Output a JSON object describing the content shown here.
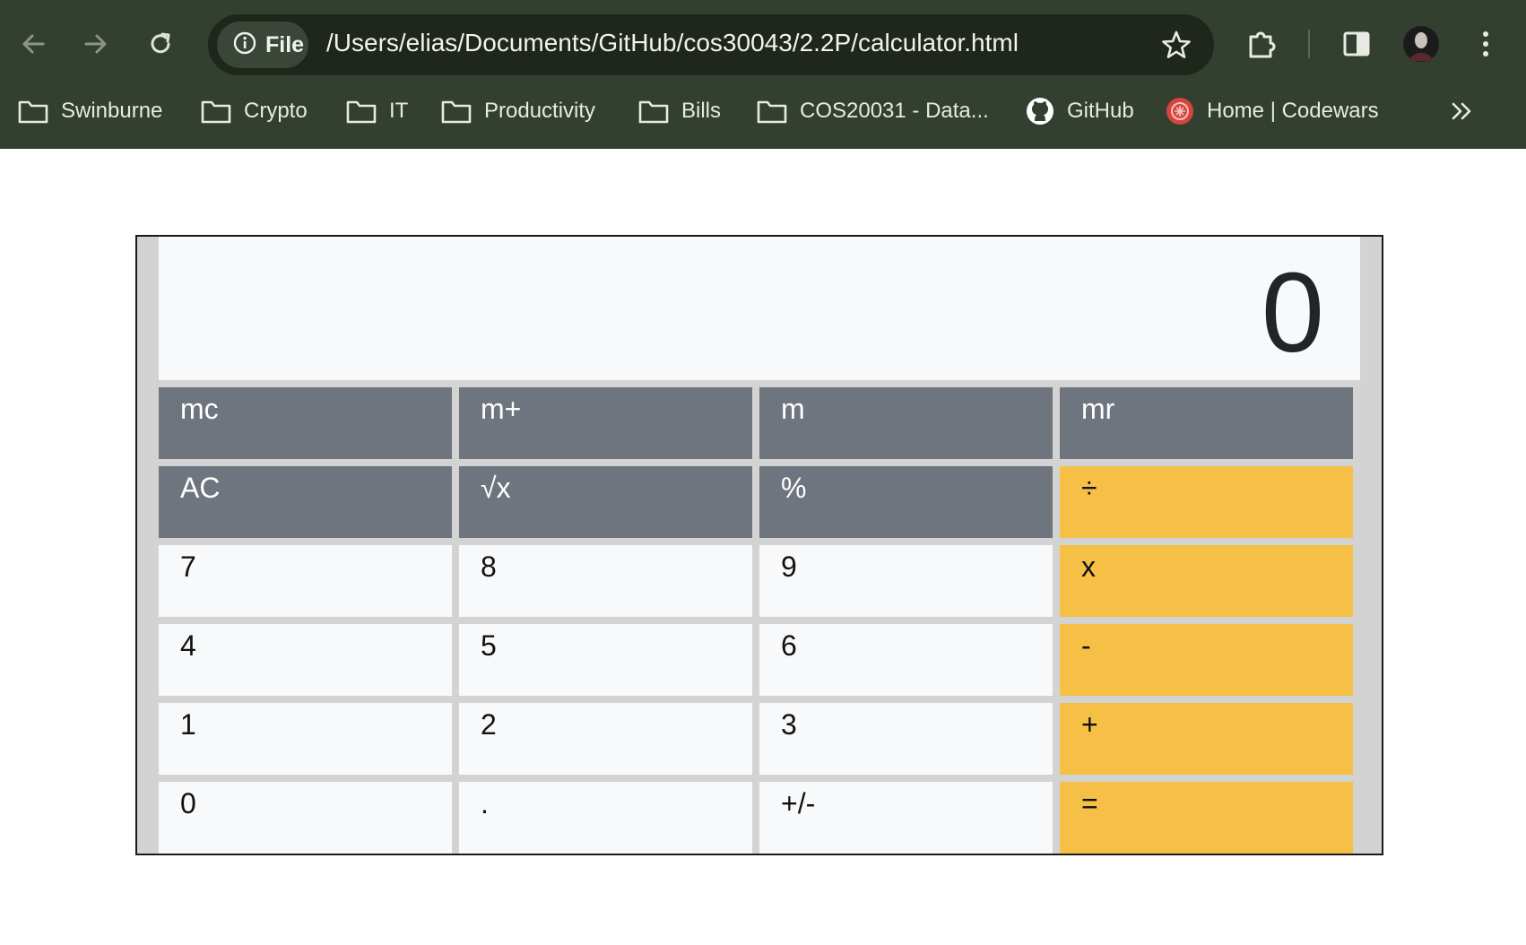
{
  "browser": {
    "file_chip_label": "File",
    "url": "/Users/elias/Documents/GitHub/cos30043/2.2P/calculator.html",
    "chrome_color": "#333f2f",
    "bookmarks": [
      {
        "label": "Swinburne",
        "icon": "folder-icon"
      },
      {
        "label": "Crypto",
        "icon": "folder-icon"
      },
      {
        "label": "IT",
        "icon": "folder-icon"
      },
      {
        "label": "Productivity",
        "icon": "folder-icon"
      },
      {
        "label": "Bills",
        "icon": "folder-icon"
      },
      {
        "label": "COS20031 - Data...",
        "icon": "folder-icon"
      },
      {
        "label": "GitHub",
        "icon": "github-icon"
      },
      {
        "label": "Home | Codewars",
        "icon": "codewars-icon"
      }
    ]
  },
  "calculator": {
    "display": "0",
    "colors": {
      "function": "#6f757e",
      "number": "#f8f9fa",
      "operator": "#f5c045",
      "frame": "#d3d3d3"
    },
    "rows": [
      [
        {
          "label": "mc",
          "kind": "function"
        },
        {
          "label": "m+",
          "kind": "function"
        },
        {
          "label": "m",
          "kind": "function"
        },
        {
          "label": "mr",
          "kind": "function"
        }
      ],
      [
        {
          "label": "AC",
          "kind": "function"
        },
        {
          "label": "√x",
          "kind": "function"
        },
        {
          "label": "%",
          "kind": "function"
        },
        {
          "label": "÷",
          "kind": "operator"
        }
      ],
      [
        {
          "label": "7",
          "kind": "number"
        },
        {
          "label": "8",
          "kind": "number"
        },
        {
          "label": "9",
          "kind": "number"
        },
        {
          "label": "x",
          "kind": "operator"
        }
      ],
      [
        {
          "label": "4",
          "kind": "number"
        },
        {
          "label": "5",
          "kind": "number"
        },
        {
          "label": "6",
          "kind": "number"
        },
        {
          "label": "-",
          "kind": "operator"
        }
      ],
      [
        {
          "label": "1",
          "kind": "number"
        },
        {
          "label": "2",
          "kind": "number"
        },
        {
          "label": "3",
          "kind": "number"
        },
        {
          "label": "+",
          "kind": "operator"
        }
      ],
      [
        {
          "label": "0",
          "kind": "number"
        },
        {
          "label": ".",
          "kind": "number"
        },
        {
          "label": "+/-",
          "kind": "number"
        },
        {
          "label": "=",
          "kind": "operator"
        }
      ]
    ]
  }
}
